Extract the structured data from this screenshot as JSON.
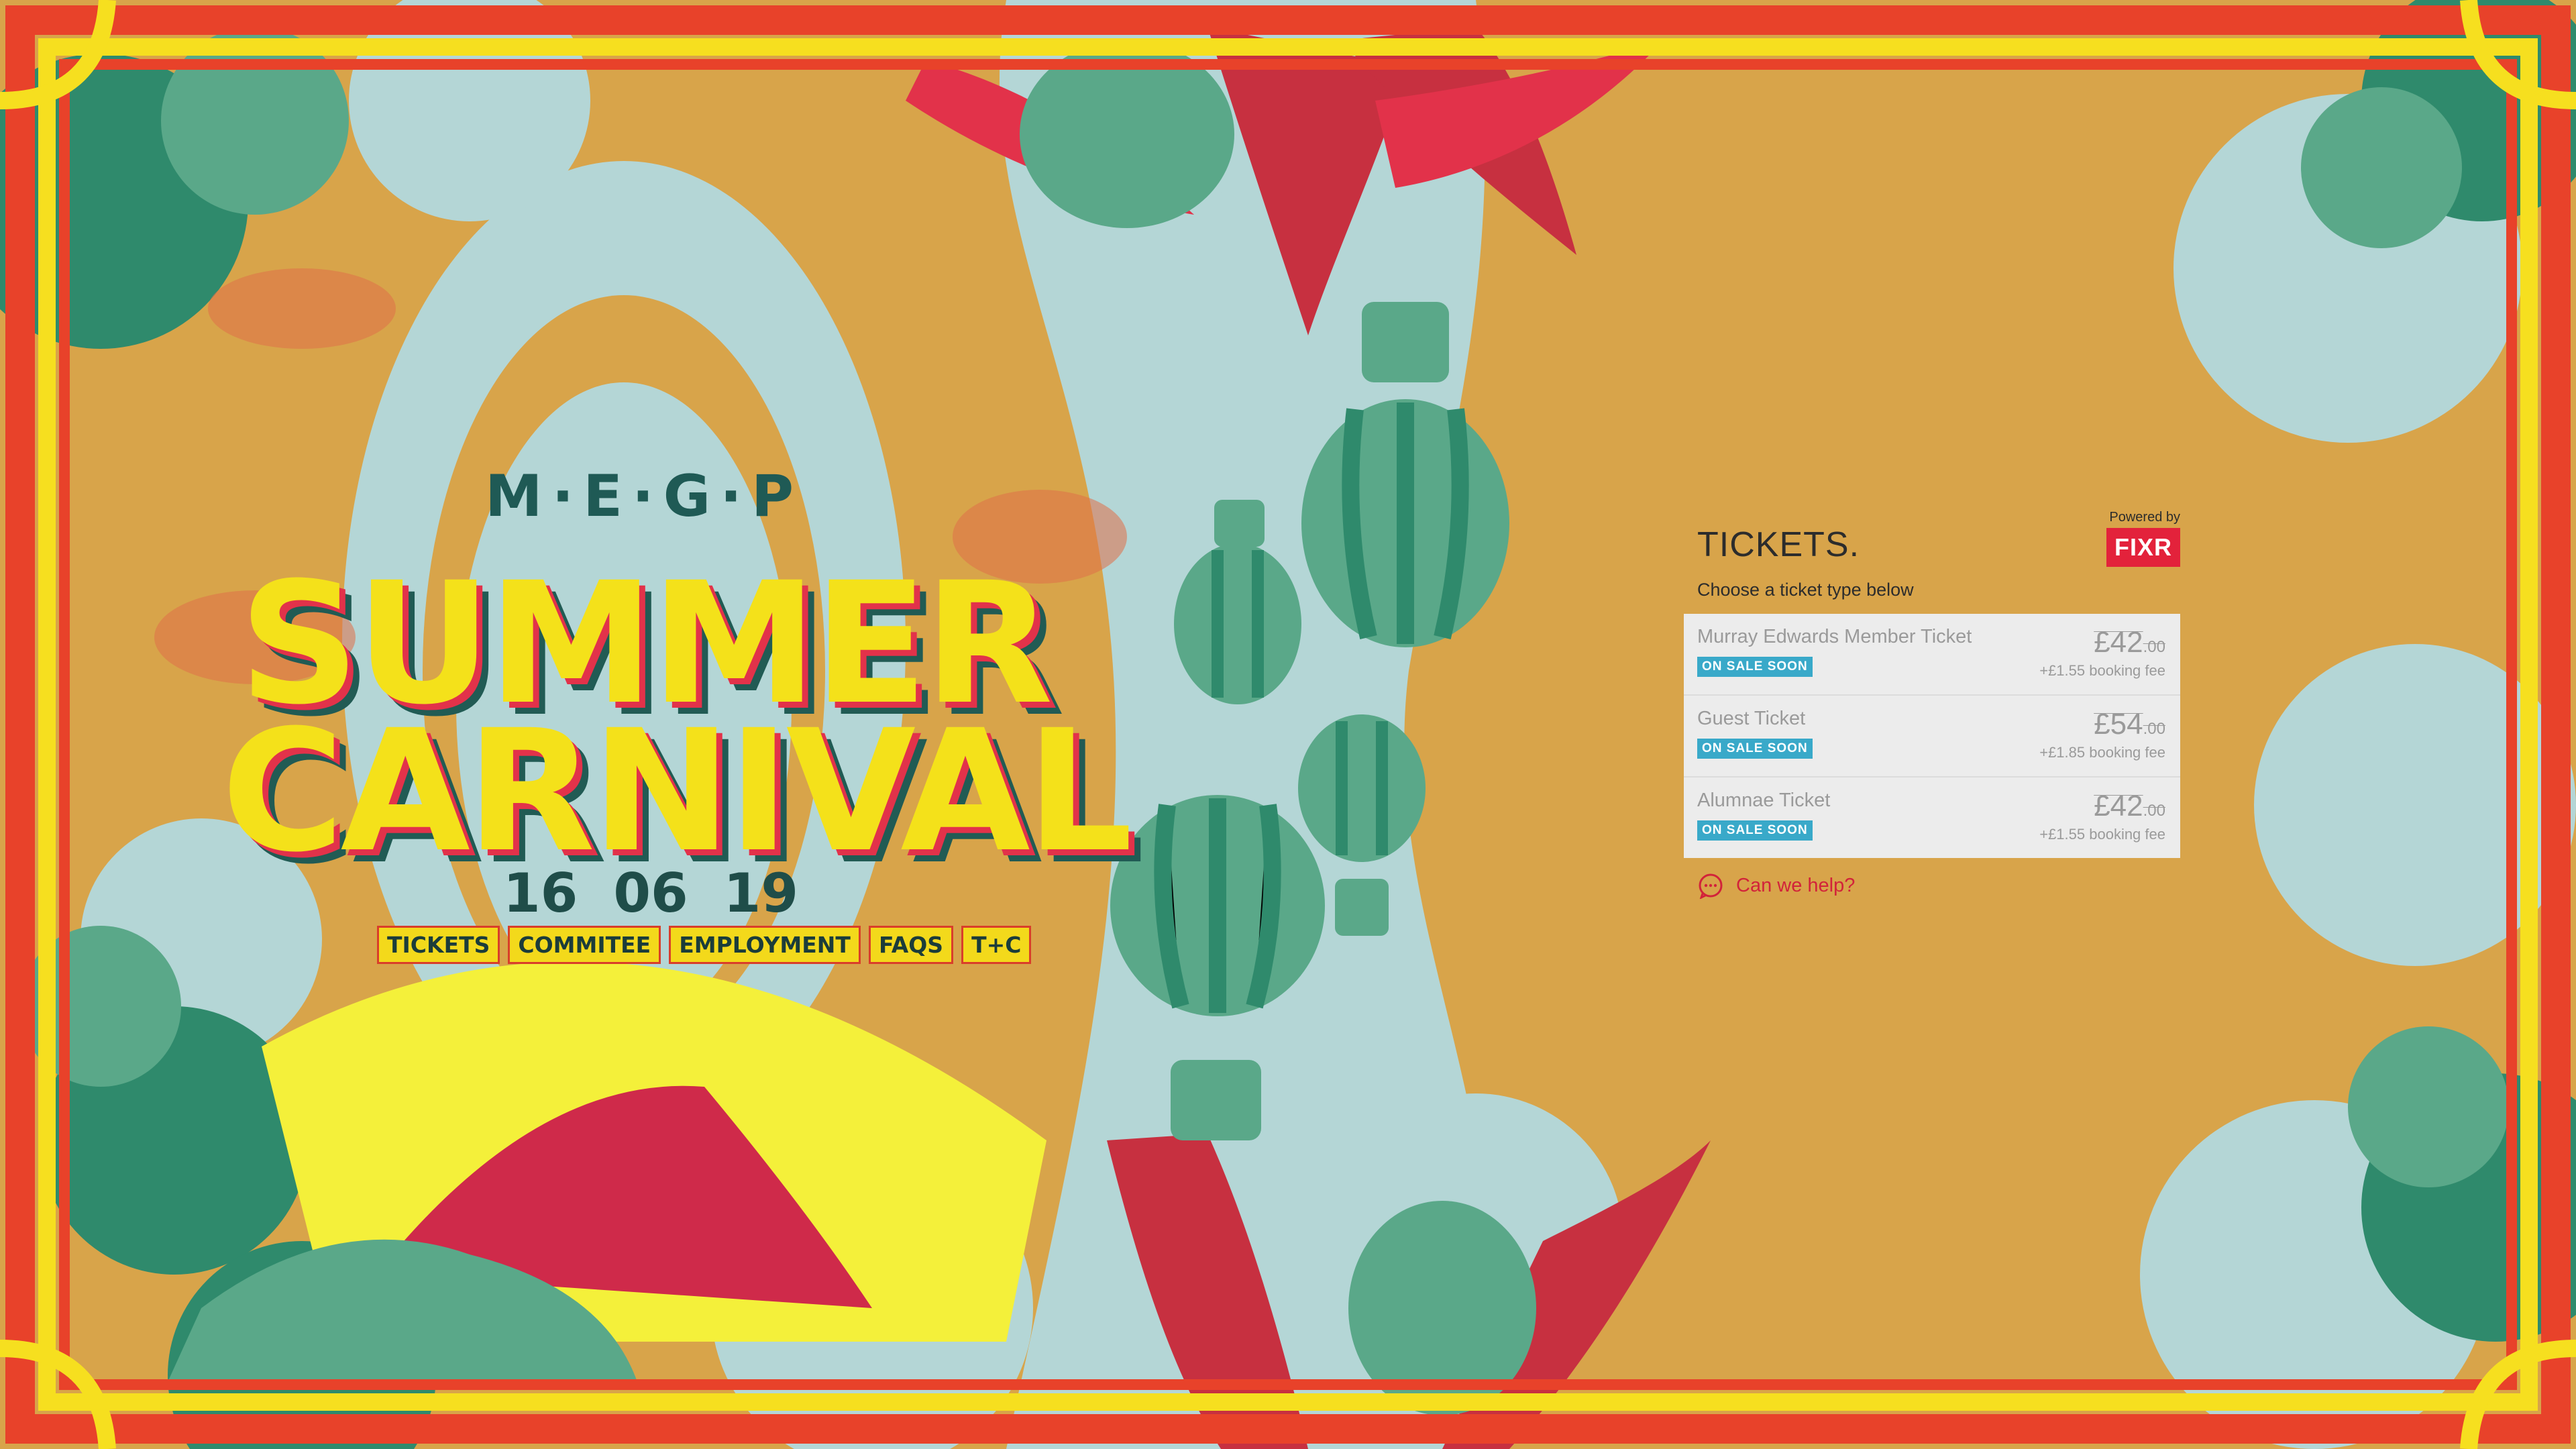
{
  "logo": {
    "initials": "M·E·G·P",
    "line1": "SUMMER",
    "line2": "CARNIVAL",
    "date": [
      "16",
      "06",
      "19"
    ]
  },
  "nav": [
    "TICKETS",
    "COMMITEE",
    "EMPLOYMENT",
    "FAQS",
    "T+C"
  ],
  "tickets": {
    "title": "TICKETS.",
    "subtitle": "Choose a ticket type below",
    "powered_by": "Powered by",
    "brand": "FIXR",
    "items": [
      {
        "name": "Murray Edwards Member Ticket",
        "badge": "ON SALE SOON",
        "price": "£42",
        "price_dec": ".00",
        "fee": "+£1.55 booking fee"
      },
      {
        "name": "Guest Ticket",
        "badge": "ON SALE SOON",
        "price": "£54",
        "price_dec": ".00",
        "fee": "+£1.85 booking fee"
      },
      {
        "name": "Alumnae Ticket",
        "badge": "ON SALE SOON",
        "price": "£42",
        "price_dec": ".00",
        "fee": "+£1.55 booking fee"
      }
    ],
    "help": "Can we help?"
  },
  "colors": {
    "frame_red": "#e8422a",
    "frame_yellow": "#f6df1f",
    "mustard": "#d8a44a",
    "pale_blue": "#b4d6d6",
    "green": "#5aa889",
    "dark_green": "#2f8a6c",
    "red_wing": "#c73040",
    "fixr_red": "#e3223b",
    "badge_blue": "#39a9c9"
  }
}
